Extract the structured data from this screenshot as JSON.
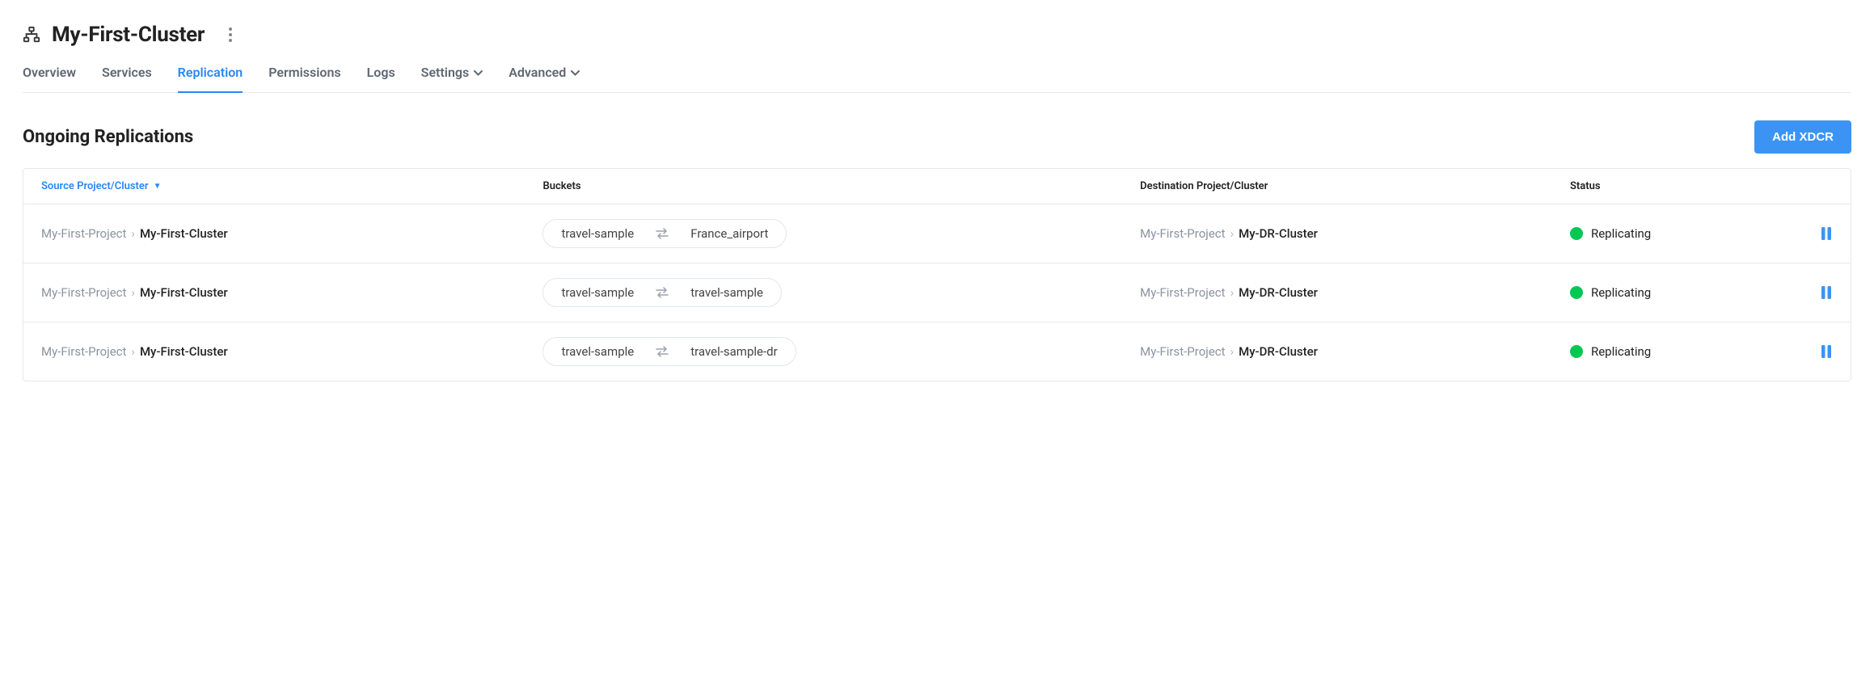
{
  "header": {
    "title": "My-First-Cluster"
  },
  "tabs": [
    {
      "id": "overview",
      "label": "Overview",
      "active": false,
      "dropdown": false
    },
    {
      "id": "services",
      "label": "Services",
      "active": false,
      "dropdown": false
    },
    {
      "id": "replication",
      "label": "Replication",
      "active": true,
      "dropdown": false
    },
    {
      "id": "permissions",
      "label": "Permissions",
      "active": false,
      "dropdown": false
    },
    {
      "id": "logs",
      "label": "Logs",
      "active": false,
      "dropdown": false
    },
    {
      "id": "settings",
      "label": "Settings",
      "active": false,
      "dropdown": true
    },
    {
      "id": "advanced",
      "label": "Advanced",
      "active": false,
      "dropdown": true
    }
  ],
  "section": {
    "title": "Ongoing Replications",
    "add_button": "Add XDCR"
  },
  "columns": {
    "source": "Source Project/Cluster",
    "buckets": "Buckets",
    "destination": "Destination Project/Cluster",
    "status": "Status"
  },
  "rows": [
    {
      "source_project": "My-First-Project",
      "source_cluster": "My-First-Cluster",
      "bucket_src": "travel-sample",
      "bucket_dst": "France_airport",
      "dest_project": "My-First-Project",
      "dest_cluster": "My-DR-Cluster",
      "status": "Replicating"
    },
    {
      "source_project": "My-First-Project",
      "source_cluster": "My-First-Cluster",
      "bucket_src": "travel-sample",
      "bucket_dst": "travel-sample",
      "dest_project": "My-First-Project",
      "dest_cluster": "My-DR-Cluster",
      "status": "Replicating"
    },
    {
      "source_project": "My-First-Project",
      "source_cluster": "My-First-Cluster",
      "bucket_src": "travel-sample",
      "bucket_dst": "travel-sample-dr",
      "dest_project": "My-First-Project",
      "dest_cluster": "My-DR-Cluster",
      "status": "Replicating"
    }
  ]
}
